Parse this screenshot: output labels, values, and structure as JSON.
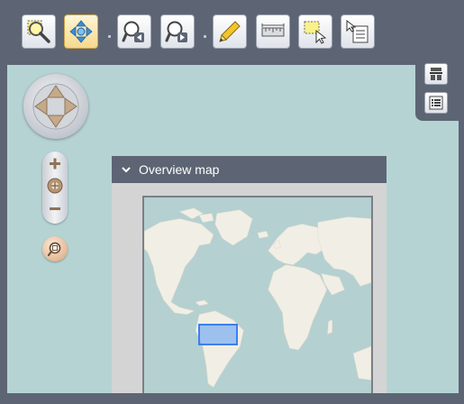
{
  "toolbar": {
    "buttons": [
      {
        "name": "zoom-box-tool-button",
        "icon": "magnifier-box-icon",
        "active": false
      },
      {
        "name": "pan-tool-button",
        "icon": "pan-arrows-icon",
        "active": true
      },
      {
        "name": "zoom-previous-button",
        "icon": "zoom-back-icon",
        "active": false
      },
      {
        "name": "zoom-next-button",
        "icon": "zoom-forward-icon",
        "active": false
      },
      {
        "name": "draw-button",
        "icon": "pencil-icon",
        "active": false
      },
      {
        "name": "measure-button",
        "icon": "ruler-icon",
        "active": false
      },
      {
        "name": "select-features-button",
        "icon": "select-box-icon",
        "active": false
      },
      {
        "name": "identify-button",
        "icon": "identify-list-icon",
        "active": false
      }
    ]
  },
  "side_tabs": {
    "items": [
      {
        "name": "layers-tab",
        "icon": "layers-icon"
      },
      {
        "name": "legend-tab",
        "icon": "legend-list-icon"
      }
    ]
  },
  "navigation": {
    "pan_icon": "pan-compass-icon",
    "zoom_in_icon": "plus-icon",
    "zoom_out_icon": "minus-icon",
    "zoom_extent_icon": "full-extent-icon"
  },
  "overview": {
    "title": "Overview map",
    "toggle_icon": "chevron-down-icon",
    "map_image": "world-map"
  },
  "colors": {
    "toolbar_bg": "#5d6574",
    "map_water": "#b6d3d4",
    "land": "#f1efe5",
    "active_button": "#f7d98c",
    "extent_box": "#3c7ff0"
  }
}
